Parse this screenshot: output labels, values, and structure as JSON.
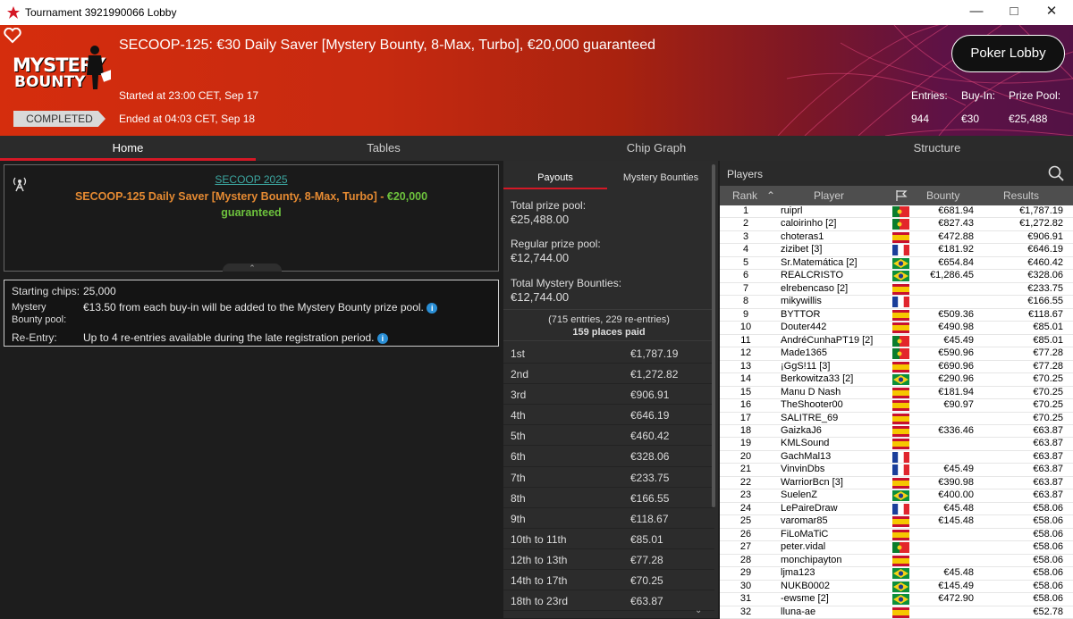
{
  "window": {
    "title": "Tournament 3921990066 Lobby"
  },
  "header": {
    "tournament_title": "SECOOP-125: €30 Daily Saver [Mystery Bounty, 8-Max, Turbo], €20,000 guaranteed",
    "brand_line1": "MYSTERY",
    "brand_line2": "BOUNTY",
    "started": "Started at 23:00 CET, Sep 17",
    "ended": "Ended at 04:03 CET, Sep 18",
    "status_badge": "COMPLETED",
    "poker_lobby_button": "Poker Lobby",
    "stats": {
      "entries_label": "Entries:",
      "entries_value": "944",
      "buyin_label": "Buy-In:",
      "buyin_value": "€30",
      "prizepool_label": "Prize Pool:",
      "prizepool_value": "€25,488"
    }
  },
  "nav_tabs": [
    "Home",
    "Tables",
    "Chip Graph",
    "Structure"
  ],
  "info": {
    "series_link": "SECOOP 2025",
    "event_name": "SECOOP-125 Daily Saver [Mystery Bounty, 8-Max, Turbo]",
    "event_sep": " - ",
    "event_guarantee_amount": "€20,000",
    "event_guarantee_word": "guaranteed",
    "starting_chips_label": "Starting chips:",
    "starting_chips_value": "25,000",
    "mb_pool_label_1": "Mystery",
    "mb_pool_label_2": "Bounty pool:",
    "mb_pool_value": "€13.50 from each buy-in will be added to the Mystery Bounty prize pool.",
    "reentry_label": "Re-Entry:",
    "reentry_value": "Up to 4 re-entries available during the late registration period."
  },
  "payouts": {
    "tab_payouts": "Payouts",
    "tab_bounties": "Mystery Bounties",
    "total_label": "Total prize pool:",
    "total_value": "€25,488.00",
    "regular_label": "Regular prize pool:",
    "regular_value": "€12,744.00",
    "mb_label": "Total Mystery Bounties:",
    "mb_value": "€12,744.00",
    "entries_note": "(715 entries, 229 re-entries)",
    "places_paid": "159 places paid",
    "rows": [
      {
        "place": "1st",
        "prize": "€1,787.19"
      },
      {
        "place": "2nd",
        "prize": "€1,272.82"
      },
      {
        "place": "3rd",
        "prize": "€906.91"
      },
      {
        "place": "4th",
        "prize": "€646.19"
      },
      {
        "place": "5th",
        "prize": "€460.42"
      },
      {
        "place": "6th",
        "prize": "€328.06"
      },
      {
        "place": "7th",
        "prize": "€233.75"
      },
      {
        "place": "8th",
        "prize": "€166.55"
      },
      {
        "place": "9th",
        "prize": "€118.67"
      },
      {
        "place": "10th to 11th",
        "prize": "€85.01"
      },
      {
        "place": "12th to 13th",
        "prize": "€77.28"
      },
      {
        "place": "14th to 17th",
        "prize": "€70.25"
      },
      {
        "place": "18th to 23rd",
        "prize": "€63.87"
      }
    ]
  },
  "players": {
    "panel_title": "Players",
    "col_rank": "Rank",
    "col_player": "Player",
    "col_bounty": "Bounty",
    "col_results": "Results",
    "rows": [
      {
        "rank": "1",
        "name": "ruiprl",
        "flag": "pt",
        "bounty": "€681.94",
        "result": "€1,787.19"
      },
      {
        "rank": "2",
        "name": "caloirinho [2]",
        "flag": "pt",
        "bounty": "€827.43",
        "result": "€1,272.82"
      },
      {
        "rank": "3",
        "name": "choteras1",
        "flag": "es",
        "bounty": "€472.88",
        "result": "€906.91"
      },
      {
        "rank": "4",
        "name": "zizibet [3]",
        "flag": "fr",
        "bounty": "€181.92",
        "result": "€646.19"
      },
      {
        "rank": "5",
        "name": "Sr.Matemática [2]",
        "flag": "br",
        "bounty": "€654.84",
        "result": "€460.42"
      },
      {
        "rank": "6",
        "name": "REALCRISTO",
        "flag": "br",
        "bounty": "€1,286.45",
        "result": "€328.06"
      },
      {
        "rank": "7",
        "name": "elrebencaso [2]",
        "flag": "es",
        "bounty": "",
        "result": "€233.75"
      },
      {
        "rank": "8",
        "name": "mikywillis",
        "flag": "fr",
        "bounty": "",
        "result": "€166.55"
      },
      {
        "rank": "9",
        "name": "BYTTOR",
        "flag": "es",
        "bounty": "€509.36",
        "result": "€118.67"
      },
      {
        "rank": "10",
        "name": "Douter442",
        "flag": "es",
        "bounty": "€490.98",
        "result": "€85.01"
      },
      {
        "rank": "11",
        "name": "AndréCunhaPT19 [2]",
        "flag": "pt",
        "bounty": "€45.49",
        "result": "€85.01"
      },
      {
        "rank": "12",
        "name": "Made1365",
        "flag": "pt",
        "bounty": "€590.96",
        "result": "€77.28"
      },
      {
        "rank": "13",
        "name": "¡GgS!11 [3]",
        "flag": "es",
        "bounty": "€690.96",
        "result": "€77.28"
      },
      {
        "rank": "14",
        "name": "Berkowitza33 [2]",
        "flag": "br",
        "bounty": "€290.96",
        "result": "€70.25"
      },
      {
        "rank": "15",
        "name": "Manu D Nash",
        "flag": "es",
        "bounty": "€181.94",
        "result": "€70.25"
      },
      {
        "rank": "16",
        "name": "TheShooter00",
        "flag": "es",
        "bounty": "€90.97",
        "result": "€70.25"
      },
      {
        "rank": "17",
        "name": "SALITRE_69",
        "flag": "es",
        "bounty": "",
        "result": "€70.25"
      },
      {
        "rank": "18",
        "name": "GaizkaJ6",
        "flag": "es",
        "bounty": "€336.46",
        "result": "€63.87"
      },
      {
        "rank": "19",
        "name": "KMLSound",
        "flag": "es",
        "bounty": "",
        "result": "€63.87"
      },
      {
        "rank": "20",
        "name": "GachMal13",
        "flag": "fr",
        "bounty": "",
        "result": "€63.87"
      },
      {
        "rank": "21",
        "name": "VinvinDbs",
        "flag": "fr",
        "bounty": "€45.49",
        "result": "€63.87"
      },
      {
        "rank": "22",
        "name": "WarriorBcn [3]",
        "flag": "es",
        "bounty": "€390.98",
        "result": "€63.87"
      },
      {
        "rank": "23",
        "name": "SuelenZ",
        "flag": "br",
        "bounty": "€400.00",
        "result": "€63.87"
      },
      {
        "rank": "24",
        "name": "LePaireDraw",
        "flag": "fr",
        "bounty": "€45.48",
        "result": "€58.06"
      },
      {
        "rank": "25",
        "name": "varomar85",
        "flag": "es",
        "bounty": "€145.48",
        "result": "€58.06"
      },
      {
        "rank": "26",
        "name": "FiLoMaTiC",
        "flag": "es",
        "bounty": "",
        "result": "€58.06"
      },
      {
        "rank": "27",
        "name": "peter.vidal",
        "flag": "pt",
        "bounty": "",
        "result": "€58.06"
      },
      {
        "rank": "28",
        "name": "monchipayton",
        "flag": "es",
        "bounty": "",
        "result": "€58.06"
      },
      {
        "rank": "29",
        "name": "ljma123",
        "flag": "br",
        "bounty": "€45.48",
        "result": "€58.06"
      },
      {
        "rank": "30",
        "name": "NUKB0002",
        "flag": "br",
        "bounty": "€145.49",
        "result": "€58.06"
      },
      {
        "rank": "31",
        "name": "-ewsme [2]",
        "flag": "br",
        "bounty": "€472.90",
        "result": "€58.06"
      },
      {
        "rank": "32",
        "name": "lluna-ae",
        "flag": "es",
        "bounty": "",
        "result": "€52.78"
      }
    ]
  },
  "colors": {
    "accent_red": "#d51826",
    "event_orange": "#e58a32",
    "guarantee_green": "#6dc23d",
    "link_teal": "#3ca6a0"
  }
}
